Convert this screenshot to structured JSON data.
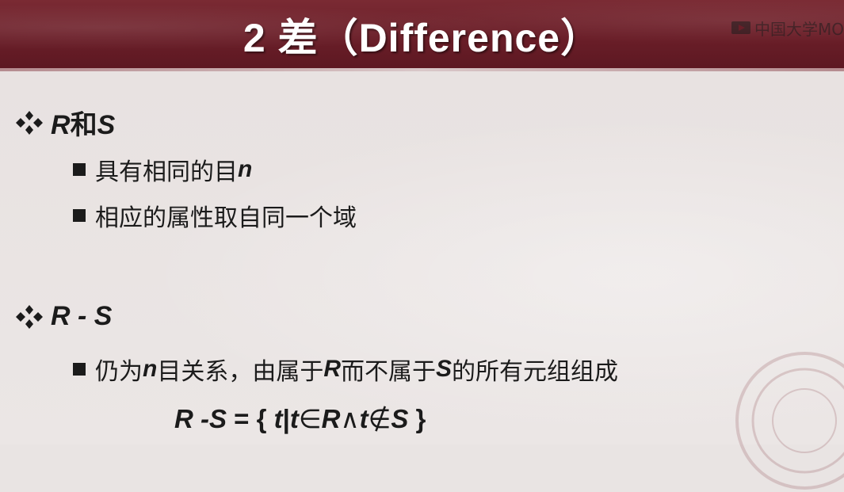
{
  "slide": {
    "title": "2 差（Difference）",
    "watermark": "中国大学MO",
    "sections": [
      {
        "label_var1": "R",
        "label_mid": "和",
        "label_var2": "S",
        "items": [
          {
            "text": "具有相同的目",
            "var": "n"
          },
          {
            "text": "相应的属性取自同一个域"
          }
        ]
      },
      {
        "label": "R - S",
        "item": {
          "p1": "仍为",
          "v1": "n",
          "p2": "目关系，由属于",
          "v2": "R",
          "p3": "而不属于",
          "v3": "S",
          "p4": "的所有元组组成"
        },
        "formula": {
          "lhs": "R -S",
          "eq": " = { ",
          "t1": "t",
          "bar": "|",
          "t2": "t",
          "in": "∈",
          "r": "R",
          "and": "∧",
          "t3": "t",
          "notin": "∉",
          "s": "S",
          "close": " }"
        }
      }
    ]
  },
  "colors": {
    "banner": "#6a1e28",
    "background": "#e9e4e3",
    "text": "#1b1b1b"
  },
  "icons": [
    "four-diamond-bullet-icon",
    "square-bullet-icon",
    "mooc-logo-icon"
  ]
}
